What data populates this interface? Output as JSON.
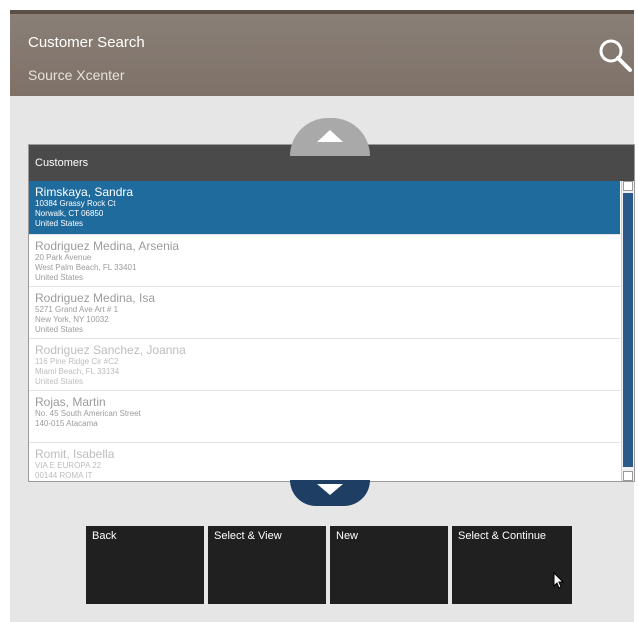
{
  "header": {
    "title": "Customer Search",
    "subtitle": "Source Xcenter"
  },
  "list": {
    "header": "Customers",
    "rows": [
      {
        "name": "Rimskaya, Sandra",
        "lines": [
          "10384 Grassy Rock Ct",
          "Norwalk, CT 06850",
          "United States"
        ],
        "selected": true
      },
      {
        "name": "Rodriguez Medina, Arsenia",
        "lines": [
          "20 Park Avenue",
          "West Palm Beach, FL 33401",
          "United States"
        ],
        "selected": false
      },
      {
        "name": "Rodriguez Medina, Isa",
        "lines": [
          "5271 Grand Ave Art # 1",
          "New York, NY 10032",
          "United States"
        ],
        "selected": false
      },
      {
        "name": "Rodriguez Sanchez, Joanna",
        "lines": [
          "116 Pine Ridge Cir #C2",
          "Miami Beach, FL 33134",
          "United States"
        ],
        "selected": false
      },
      {
        "name": "Rojas, Martin",
        "lines": [
          "No. 45 South American Street",
          "140-015 Atacama"
        ],
        "selected": false
      },
      {
        "name": "Romit, Isabella",
        "lines": [
          "VIA E EUROPA 22",
          "00144 ROMA IT"
        ],
        "selected": false
      }
    ]
  },
  "actions": {
    "back": "Back",
    "select_view": "Select & View",
    "new": "New",
    "select_continue": "Select & Continue"
  },
  "icons": {
    "search": "search-icon",
    "up": "chevron-up-icon",
    "down": "chevron-down-icon"
  },
  "colors": {
    "header_bg": "#7d7168",
    "selected_row": "#1f6b9e",
    "nav_down": "#1e3f63",
    "action_bg": "#202020"
  }
}
